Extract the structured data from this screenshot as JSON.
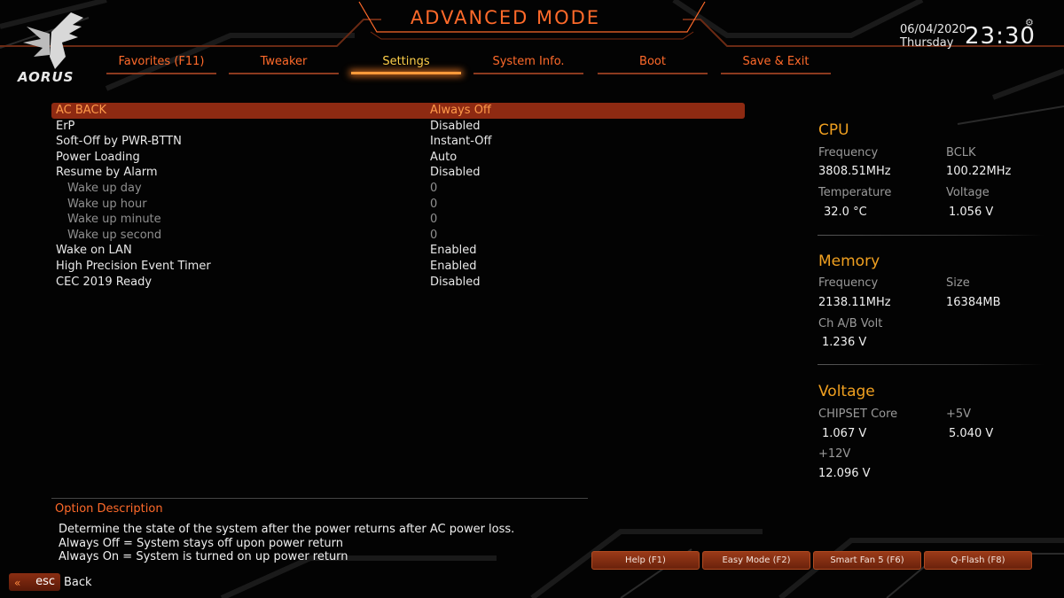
{
  "header": {
    "logo_text": "AORUS",
    "mode_title": "ADVANCED MODE",
    "date": "06/04/2020",
    "weekday": "Thursday",
    "time": "23:30",
    "tabs": [
      {
        "label": "Favorites (F11)",
        "active": false
      },
      {
        "label": "Tweaker",
        "active": false
      },
      {
        "label": "Settings",
        "active": true
      },
      {
        "label": "System Info.",
        "active": false
      },
      {
        "label": "Boot",
        "active": false
      },
      {
        "label": "Save & Exit",
        "active": false
      }
    ]
  },
  "settings": [
    {
      "label": "AC BACK",
      "value": "Always Off",
      "selected": true
    },
    {
      "label": "ErP",
      "value": "Disabled"
    },
    {
      "label": "Soft-Off by PWR-BTTN",
      "value": "Instant-Off"
    },
    {
      "label": "Power Loading",
      "value": "Auto"
    },
    {
      "label": "Resume by Alarm",
      "value": "Disabled"
    },
    {
      "label": "Wake up day",
      "value": "0",
      "sub": true
    },
    {
      "label": "Wake up hour",
      "value": "0",
      "sub": true
    },
    {
      "label": "Wake up minute",
      "value": "0",
      "sub": true
    },
    {
      "label": "Wake up second",
      "value": "0",
      "sub": true
    },
    {
      "label": "Wake on LAN",
      "value": "Enabled"
    },
    {
      "label": "High Precision Event Timer",
      "value": "Enabled"
    },
    {
      "label": "CEC 2019 Ready",
      "value": "Disabled"
    }
  ],
  "cpu": {
    "title": "CPU",
    "freq_label": "Frequency",
    "freq_value": "3808.51MHz",
    "bclk_label": "BCLK",
    "bclk_value": "100.22MHz",
    "temp_label": "Temperature",
    "temp_value": "32.0 °C",
    "volt_label": "Voltage",
    "volt_value": "1.056 V"
  },
  "memory": {
    "title": "Memory",
    "freq_label": "Frequency",
    "freq_value": "2138.11MHz",
    "size_label": "Size",
    "size_value": "16384MB",
    "chvolt_label": "Ch A/B Volt",
    "chvolt_value": "1.236 V"
  },
  "voltage": {
    "title": "Voltage",
    "chipset_label": "CHIPSET Core",
    "chipset_value": "1.067 V",
    "p5v_label": "+5V",
    "p5v_value": "5.040 V",
    "p12v_label": "+12V",
    "p12v_value": "12.096 V"
  },
  "description": {
    "title": "Option Description",
    "lines": [
      "Determine the state of  the system after the power returns after AC power loss.",
      "Always Off = System stays off upon power return",
      "Always On = System is turned on up power return"
    ]
  },
  "footer": {
    "esc_key": "esc",
    "esc_label": "Back",
    "buttons": [
      "Help (F1)",
      "Easy Mode (F2)",
      "Smart Fan 5 (F6)",
      "Q-Flash (F8)"
    ]
  },
  "colors": {
    "accent": "#ff6a2a",
    "active_tab": "#ffd04a",
    "section_title": "#f0a020",
    "selected_row": "#8e2a12"
  }
}
